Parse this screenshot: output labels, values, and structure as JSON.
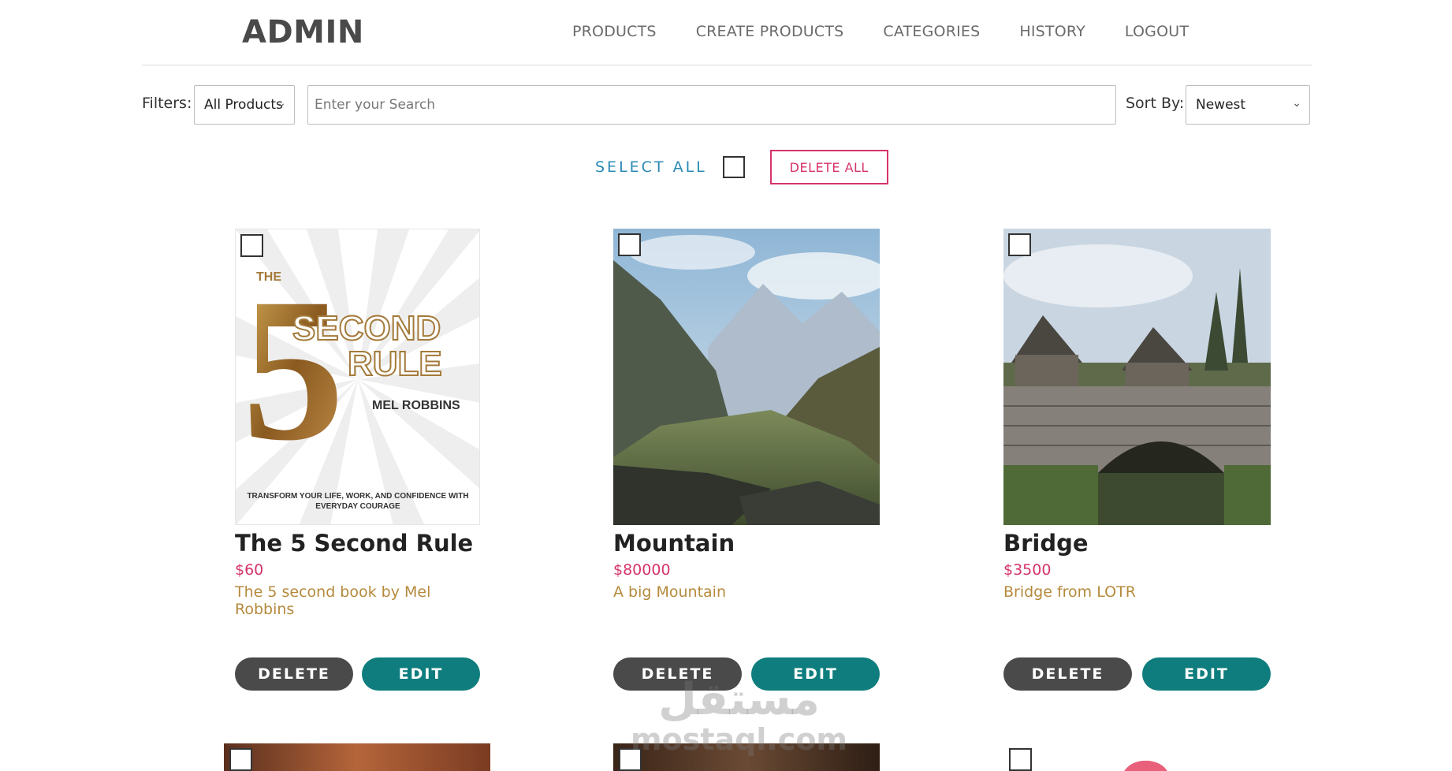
{
  "header": {
    "brand": "ADMIN",
    "nav": [
      "PRODUCTS",
      "CREATE PRODUCTS",
      "CATEGORIES",
      "HISTORY",
      "LOGOUT"
    ]
  },
  "filters": {
    "label": "Filters:",
    "category_selected": "All Products",
    "search_placeholder": "Enter your Search",
    "sort_label": "Sort By:",
    "sort_selected": "Newest"
  },
  "bulk": {
    "select_all_label": "SELECT ALL",
    "delete_all_label": "DELETE ALL"
  },
  "buttons": {
    "delete": "DELETE",
    "edit": "EDIT"
  },
  "products": [
    {
      "title": "The 5 Second Rule",
      "price": "$60",
      "description": "The 5 second book by Mel Robbins",
      "cover": {
        "small_top": "THE",
        "big": "5",
        "word1": "SECOND",
        "word2": "RULE",
        "author": "MEL ROBBINS",
        "tagline1": "TRANSFORM YOUR LIFE, WORK, AND CONFIDENCE WITH",
        "tagline2": "EVERYDAY COURAGE"
      }
    },
    {
      "title": "Mountain",
      "price": "$80000",
      "description": "A big Mountain"
    },
    {
      "title": "Bridge",
      "price": "$3500",
      "description": "Bridge from LOTR"
    }
  ],
  "watermark": {
    "arabic": "مستقل",
    "latin": "mostaql.com"
  },
  "colors": {
    "accent_pink": "#d6336c",
    "teal": "#0f7d7d",
    "dark_button": "#4a4a4a",
    "link_blue": "#2a8ab5",
    "desc_gold": "#b58a3c"
  }
}
